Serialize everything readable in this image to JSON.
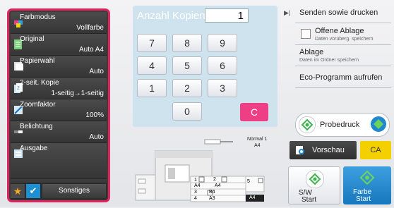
{
  "copies": {
    "label": "Anzahl Kopien",
    "value": "1"
  },
  "keypad": {
    "keys": [
      "7",
      "8",
      "9",
      "4",
      "5",
      "6",
      "1",
      "2",
      "3",
      "0"
    ],
    "clear": "C"
  },
  "settings": [
    {
      "name": "Farbmodus",
      "value": "Vollfarbe",
      "icon": "color-mode-icon"
    },
    {
      "name": "Original",
      "value": "Auto  A4",
      "icon": "original-icon"
    },
    {
      "name": "Papierwahl",
      "value": "Auto",
      "icon": "paper-select-icon"
    },
    {
      "name": "2-seit. Kopie",
      "value": "1-seitig→1-seitig",
      "icon": "duplex-icon"
    },
    {
      "name": "Zoomfaktor",
      "value": "100%",
      "icon": "zoom-icon"
    },
    {
      "name": "Belichtung",
      "value": "Auto",
      "icon": "exposure-icon"
    },
    {
      "name": "Ausgabe",
      "value": "",
      "icon": "output-icon"
    }
  ],
  "left_bottom": {
    "other_label": "Sonstiges"
  },
  "right_menu": {
    "send_print": "Senden sowie drucken",
    "hold_label": "Offene Ablage",
    "hold_sub": "Daten vorüberg. speichern",
    "filing_label": "Ablage",
    "filing_sub": "Daten im Ordner speichern",
    "eco_label": "Eco-Programm aufrufen"
  },
  "actions": {
    "sample_print": "Probedruck",
    "preview": "Vorschau",
    "ca": "CA",
    "bw_start_line1": "S/W",
    "bw_start_line2": "Start",
    "color_start_line1": "Farbe",
    "color_start_line2": "Start"
  },
  "machine": {
    "output_label_1": "Normal 1",
    "output_label_2": "A4",
    "trays": [
      {
        "num": "1",
        "size": "A4"
      },
      {
        "num": "2",
        "size": "A4"
      },
      {
        "num": "3",
        "size": "B4"
      },
      {
        "num": "4",
        "size": "A3"
      },
      {
        "num": "5",
        "size": "A4"
      }
    ]
  },
  "colors": {
    "frame": "#e0245e",
    "clear": "#ee3f86",
    "ca": "#f5d000",
    "start_color": "#1e88d0",
    "start_icon": "#3bb44a"
  }
}
